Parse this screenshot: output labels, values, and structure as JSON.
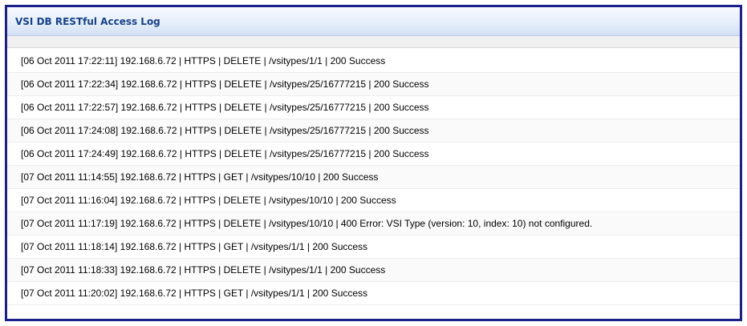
{
  "panel": {
    "title": "VSI DB RESTful Access Log"
  },
  "log_entries": [
    "[06 Oct 2011 17:22:11] 192.168.6.72 | HTTPS | DELETE | /vsitypes/1/1 | 200 Success",
    "[06 Oct 2011 17:22:34] 192.168.6.72 | HTTPS | DELETE | /vsitypes/25/16777215 | 200 Success",
    "[06 Oct 2011 17:22:57] 192.168.6.72 | HTTPS | DELETE | /vsitypes/25/16777215 | 200 Success",
    "[06 Oct 2011 17:24:08] 192.168.6.72 | HTTPS | DELETE | /vsitypes/25/16777215 | 200 Success",
    "[06 Oct 2011 17:24:49] 192.168.6.72 | HTTPS | DELETE | /vsitypes/25/16777215 | 200 Success",
    "[07 Oct 2011 11:14:55] 192.168.6.72 | HTTPS | GET | /vsitypes/10/10 | 200 Success",
    "[07 Oct 2011 11:16:04] 192.168.6.72 | HTTPS | DELETE | /vsitypes/10/10 | 200 Success",
    "[07 Oct 2011 11:17:19] 192.168.6.72 | HTTPS | DELETE | /vsitypes/10/10 | 400 Error: VSI Type (version: 10, index: 10) not configured.",
    "[07 Oct 2011 11:18:14] 192.168.6.72 | HTTPS | GET | /vsitypes/1/1 | 200 Success",
    "[07 Oct 2011 11:18:33] 192.168.6.72 | HTTPS | DELETE | /vsitypes/1/1 | 200 Success",
    "[07 Oct 2011 11:20:02] 192.168.6.72 | HTTPS | GET | /vsitypes/1/1 | 200 Success"
  ],
  "colors": {
    "frame_border": "#1b1f8c",
    "title_text": "#15428b",
    "header_bg": "#dfe8f6"
  }
}
